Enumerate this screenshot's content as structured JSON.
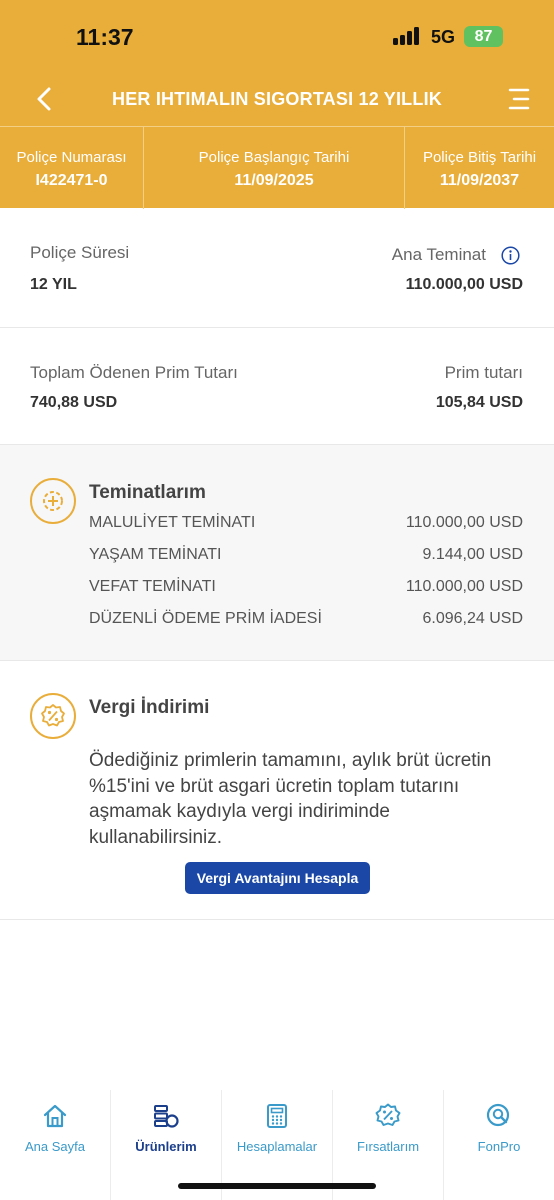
{
  "status": {
    "time": "11:37",
    "network": "5G",
    "battery": "87"
  },
  "header": {
    "title": "HER IHTIMALIN SIGORTASI 12 YILLIK"
  },
  "policy": {
    "number_label": "Poliçe Numarası",
    "number": "I422471-0",
    "start_label": "Poliçe Başlangıç Tarihi",
    "start": "11/09/2025",
    "end_label": "Poliçe Bitiş Tarihi",
    "end": "11/09/2037"
  },
  "summary": {
    "duration_label": "Poliçe Süresi",
    "duration": "12 YIL",
    "main_coverage_label": "Ana Teminat",
    "main_coverage": "110.000,00 USD",
    "total_paid_label": "Toplam Ödenen Prim Tutarı",
    "total_paid": "740,88 USD",
    "premium_label": "Prim tutarı",
    "premium": "105,84 USD"
  },
  "coverages": {
    "title": "Teminatlarım",
    "items": [
      {
        "name": "MALULİYET TEMİNATI",
        "amount": "110.000,00 USD"
      },
      {
        "name": "YAŞAM TEMİNATI",
        "amount": "9.144,00 USD"
      },
      {
        "name": "VEFAT TEMİNATI",
        "amount": "110.000,00 USD"
      },
      {
        "name": "DÜZENLİ ÖDEME PRİM İADESİ",
        "amount": "6.096,24 USD"
      }
    ]
  },
  "tax": {
    "title": "Vergi İndirimi",
    "text": "Ödediğiniz primlerin tamamını, aylık brüt ücretin %15'ini ve brüt asgari ücretin toplam tutarını aşmamak kaydıyla vergi indiriminde kullanabilirsiniz.",
    "button": "Vergi Avantajını Hesapla"
  },
  "tabs": [
    {
      "label": "Ana Sayfa",
      "icon": "home-icon"
    },
    {
      "label": "Ürünlerim",
      "icon": "products-icon",
      "active": true
    },
    {
      "label": "Hesaplamalar",
      "icon": "calculator-icon"
    },
    {
      "label": "Fırsatlarım",
      "icon": "discount-badge-icon"
    },
    {
      "label": "FonPro",
      "icon": "fund-search-icon"
    }
  ],
  "colors": {
    "brand": "#e9ad3a",
    "button": "#1b48a7",
    "tab_text": "#3a9ac9",
    "tab_active": "#1c3f8c"
  }
}
